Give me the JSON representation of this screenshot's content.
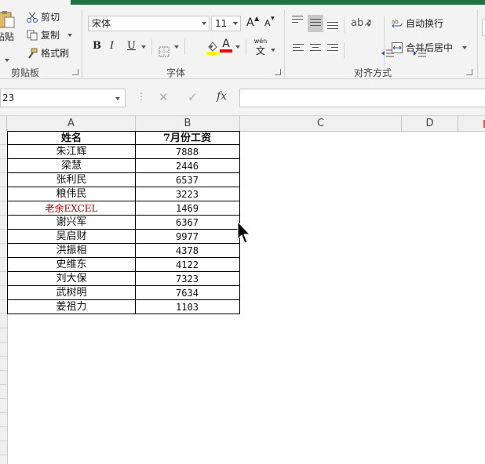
{
  "ribbon": {
    "clipboard": {
      "paste_label": "粘贴",
      "cut_label": "剪切",
      "copy_label": "复制",
      "format_painter_label": "格式刷",
      "group_label": "剪贴板"
    },
    "font": {
      "font_name": "宋体",
      "font_size": "11",
      "bold": "B",
      "italic": "I",
      "underline": "U",
      "font_color": "A",
      "grow_font": "A",
      "shrink_font": "A",
      "phonetic_label": "wén",
      "phonetic_char": "文",
      "group_label": "字体",
      "highlight_color": "#ffff00",
      "font_color_value": "#ff0000"
    },
    "alignment": {
      "wrap_text_label": "自动换行",
      "merge_center_label": "合并后居中",
      "group_label": "对齐方式"
    }
  },
  "formula_bar": {
    "name_box": "23",
    "fx_label": "fx",
    "cancel_glyph": "✕",
    "enter_glyph": "✓",
    "formula": ""
  },
  "columns": [
    "A",
    "B",
    "C",
    "D"
  ],
  "sheet": {
    "headers": [
      "姓名",
      "7月份工资"
    ],
    "rows": [
      {
        "name": "朱江辉",
        "salary": "7888"
      },
      {
        "name": "梁慧",
        "salary": "2446"
      },
      {
        "name": "张利民",
        "salary": "6537"
      },
      {
        "name": "粮伟民",
        "salary": "3223"
      },
      {
        "name": "老余EXCEL",
        "salary": "1469",
        "color": "#c00000"
      },
      {
        "name": "谢兴军",
        "salary": "6367"
      },
      {
        "name": "吴启财",
        "salary": "9977"
      },
      {
        "name": "洪振相",
        "salary": "4378"
      },
      {
        "name": "史维东",
        "salary": "4122"
      },
      {
        "name": "刘大保",
        "salary": "7323"
      },
      {
        "name": "武树明",
        "salary": "7634"
      },
      {
        "name": "姜祖力",
        "salary": "1103"
      }
    ]
  },
  "colors": {
    "excel_green": "#217346",
    "highlight_red": "#c00000"
  }
}
